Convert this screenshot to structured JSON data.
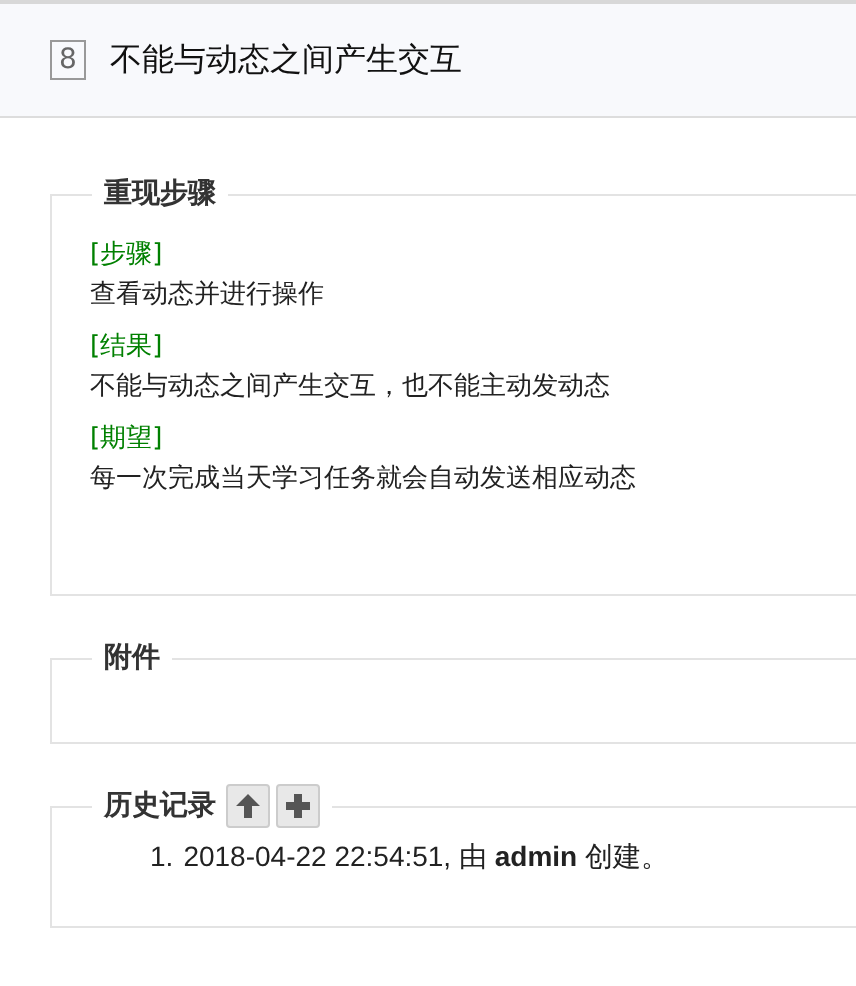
{
  "header": {
    "id": "8",
    "title": "不能与动态之间产生交互"
  },
  "steps_section": {
    "legend": "重现步骤",
    "items": [
      {
        "label": "[步骤]",
        "text": "查看动态并进行操作"
      },
      {
        "label": "[结果]",
        "text": "不能与动态之间产生交互，也不能主动发动态"
      },
      {
        "label": "[期望]",
        "text": "每一次完成当天学习任务就会自动发送相应动态"
      }
    ]
  },
  "attachments_section": {
    "legend": "附件"
  },
  "history_section": {
    "legend": "历史记录",
    "buttons": [
      {
        "kind": "up"
      },
      {
        "kind": "add"
      }
    ],
    "entries": [
      {
        "number": "1.",
        "text": "2018-04-22 22:54:51, 由 **admin** 创建。"
      }
    ]
  }
}
